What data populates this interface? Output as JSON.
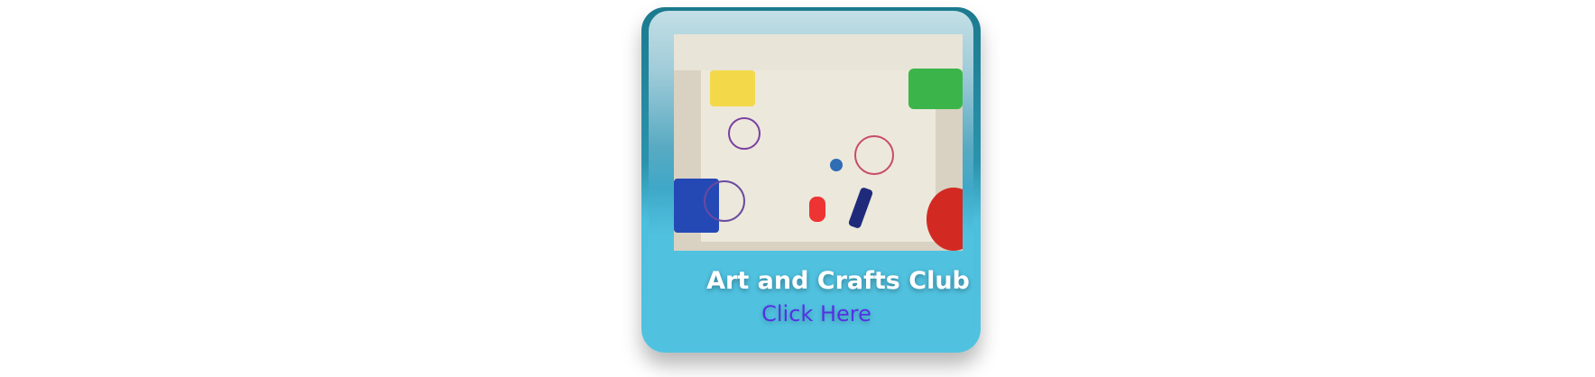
{
  "card": {
    "title": "Art and Crafts Club",
    "link_label": "Click Here",
    "accent_color": "#50c2e0",
    "link_color": "#5531e3"
  }
}
